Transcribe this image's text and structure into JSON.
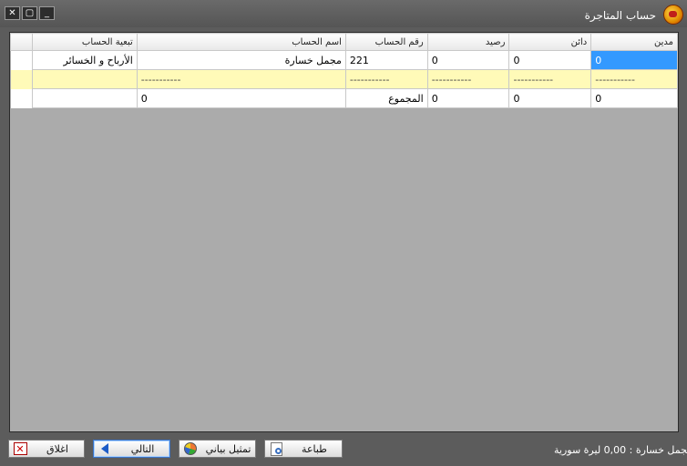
{
  "window": {
    "title": "حساب المتاجرة"
  },
  "grid": {
    "headers": [
      "مدين",
      "دائن",
      "رصيد",
      "رقم الحساب",
      "اسم الحساب",
      "تبعية الحساب"
    ],
    "row1": [
      "0",
      "0",
      "0",
      "221",
      "مجمل خسارة",
      "الأرباح و الخسائر"
    ],
    "dashes": [
      "-----------",
      "-----------",
      "-----------",
      "-----------",
      "-----------",
      ""
    ],
    "total": [
      "0",
      "0",
      "0",
      "المجموع",
      "0",
      ""
    ]
  },
  "status": {
    "label": "مجمل خسارة :",
    "value": "0,00",
    "currency": "ليرة سورية"
  },
  "buttons": {
    "print": "طباعة",
    "chart": "تمثيل بياني",
    "next": "التالي",
    "close": "اغلاق"
  },
  "icons": {
    "app": "app-logo-icon",
    "minimize": "minimize-icon",
    "maximize": "maximize-icon",
    "close": "close-icon",
    "print": "print-preview-icon",
    "chart": "pie-chart-icon",
    "next": "arrow-left-icon",
    "exit": "exit-icon"
  }
}
